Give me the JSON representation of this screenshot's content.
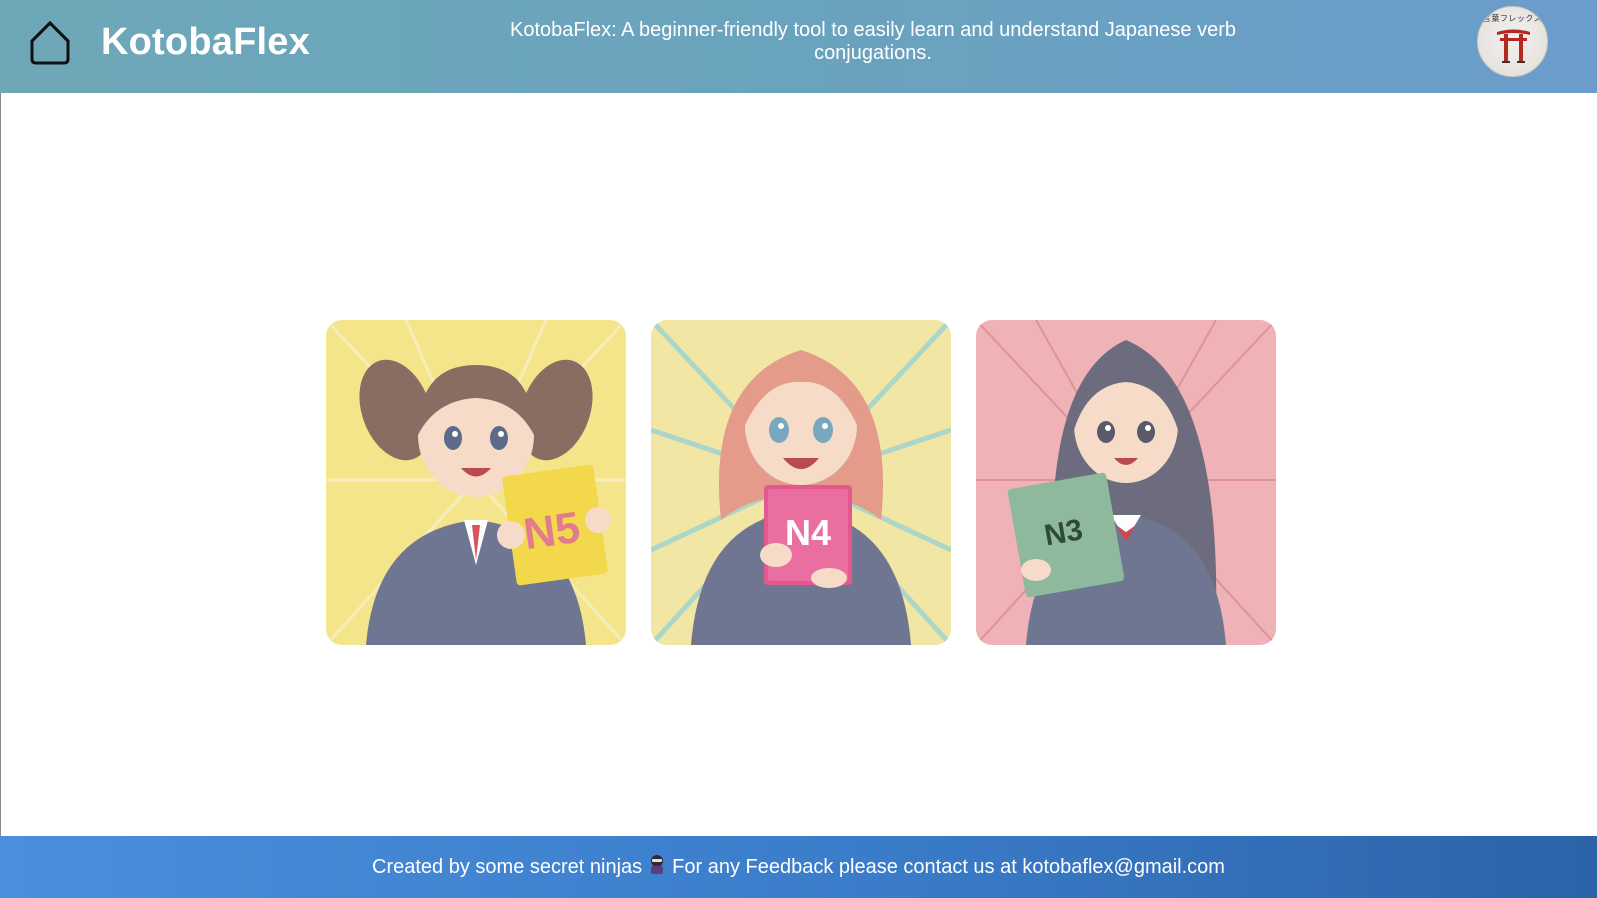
{
  "header": {
    "brand": "KotobaFlex",
    "tagline": "KotobaFlex: A beginner-friendly tool to easily learn and understand Japanese verb conjugations.",
    "home_icon": "home-icon",
    "logo": {
      "icon": "torii-gate-icon",
      "text": "言葉フレックス"
    }
  },
  "levels": [
    {
      "label": "N5",
      "background": "#f4e58a",
      "book_color": "#f2d84a"
    },
    {
      "label": "N4",
      "background": "#f2e6a4",
      "book_color": "#e4578f"
    },
    {
      "label": "N3",
      "background": "#efb2b6",
      "book_color": "#8fb99d"
    }
  ],
  "footer": {
    "text_before": "Created by some secret ninjas",
    "ninja_icon": "ninja-icon",
    "text_after": "For any Feedback please contact us at kotobaflex@gmail.com"
  },
  "colors": {
    "header_start": "#6ea8b8",
    "header_end": "#6b9ccb",
    "footer_start": "#4a8fdc",
    "footer_end": "#2c63a8"
  }
}
